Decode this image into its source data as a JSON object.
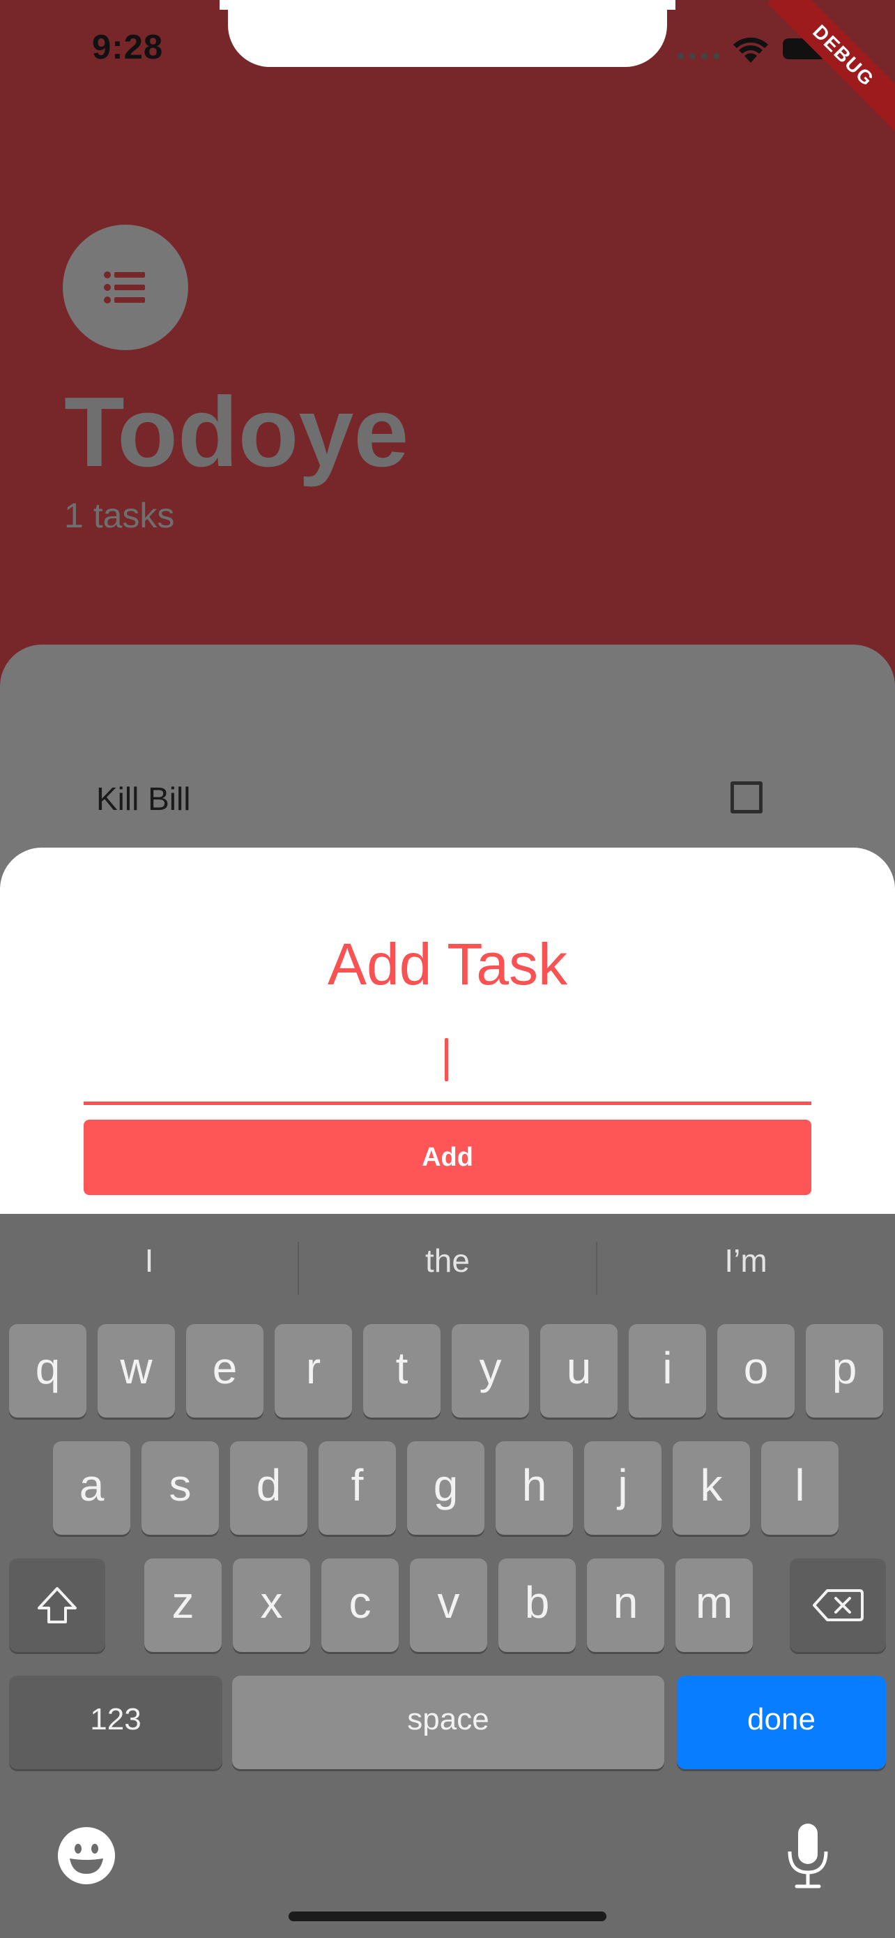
{
  "status_bar": {
    "time": "9:28",
    "debug_label": "DEBUG"
  },
  "header": {
    "title": "Todoye",
    "task_count": "1 tasks"
  },
  "tasks": [
    {
      "title": "Kill Bill",
      "done": false
    }
  ],
  "sheet": {
    "title": "Add Task",
    "input_value": "",
    "add_label": "Add"
  },
  "keyboard": {
    "suggestions": [
      "I",
      "the",
      "I’m"
    ],
    "row1": [
      "q",
      "w",
      "e",
      "r",
      "t",
      "y",
      "u",
      "i",
      "o",
      "p"
    ],
    "row2": [
      "a",
      "s",
      "d",
      "f",
      "g",
      "h",
      "j",
      "k",
      "l"
    ],
    "row3": [
      "z",
      "x",
      "c",
      "v",
      "b",
      "n",
      "m"
    ],
    "numbers_label": "123",
    "space_label": "space",
    "done_label": "done"
  },
  "colors": {
    "header_background": "#772729",
    "accent": "#f95252",
    "add_button": "#fe5557",
    "done_key": "#087dff",
    "keyboard_background": "#6b6b6b"
  },
  "icons": [
    "list-icon",
    "wifi-icon",
    "battery-icon",
    "shift-icon",
    "backspace-icon",
    "emoji-icon",
    "mic-icon"
  ]
}
